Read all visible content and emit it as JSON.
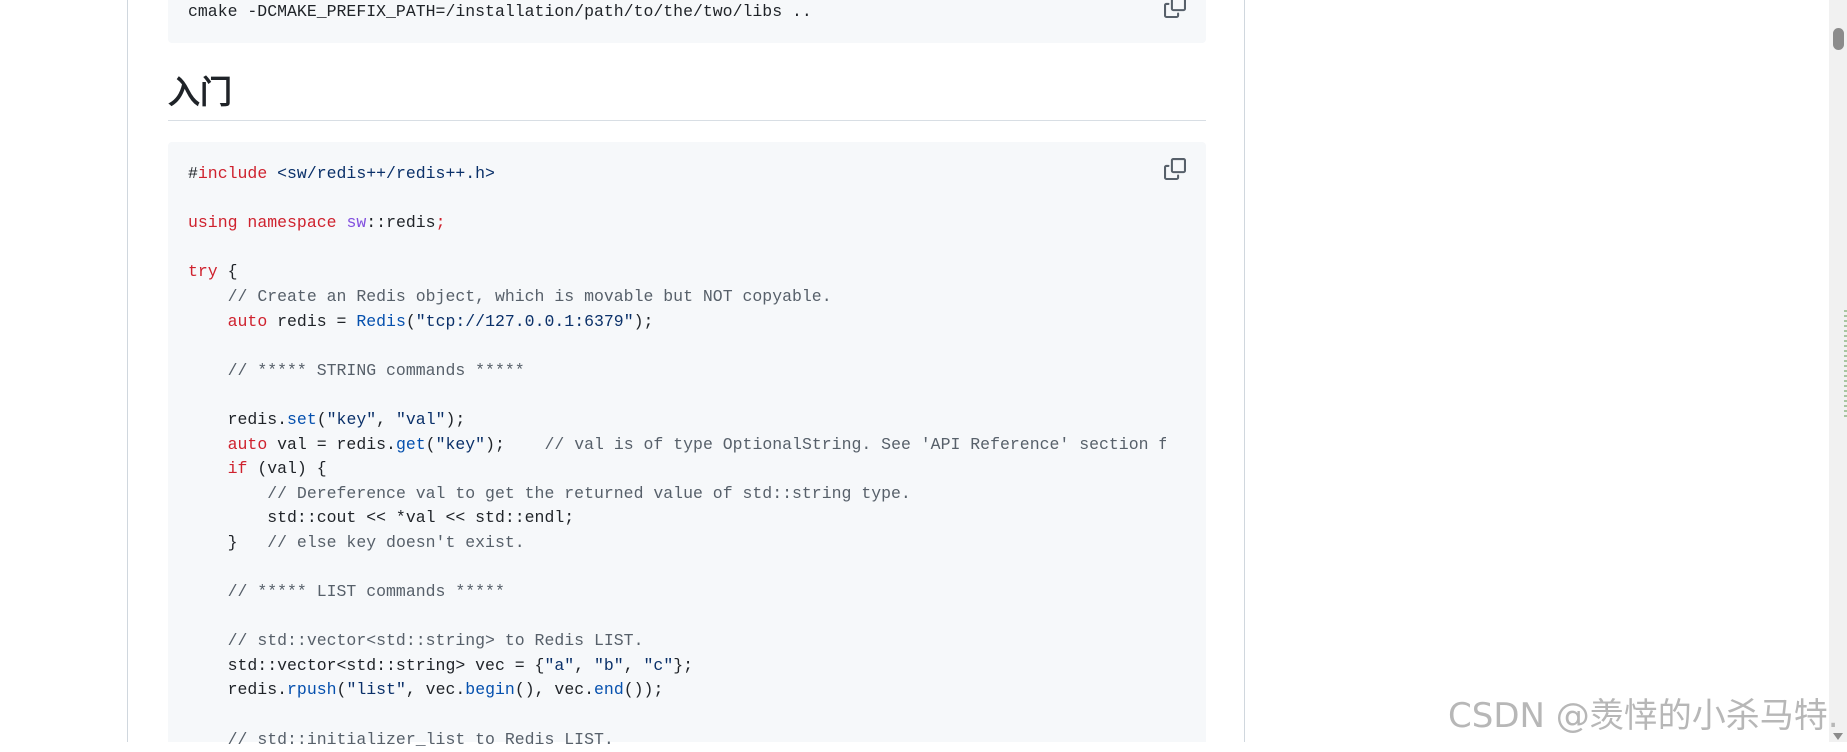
{
  "install_block": {
    "command": "cmake -DCMAKE_PREFIX_PATH=/installation/path/to/the/two/libs .."
  },
  "section": {
    "heading": "入门"
  },
  "code": {
    "lines": [
      [
        {
          "t": "#"
        },
        {
          "t": "include",
          "c": "k"
        },
        {
          "t": " "
        },
        {
          "t": "<sw/redis++/redis++.h>",
          "c": "s"
        }
      ],
      [],
      [
        {
          "t": "using",
          "c": "k"
        },
        {
          "t": " "
        },
        {
          "t": "namespace",
          "c": "k"
        },
        {
          "t": " "
        },
        {
          "t": "sw",
          "c": "n"
        },
        {
          "t": "::redis"
        },
        {
          "t": ";",
          "c": "k"
        }
      ],
      [],
      [
        {
          "t": "try",
          "c": "k"
        },
        {
          "t": " {"
        }
      ],
      [
        {
          "t": "    "
        },
        {
          "t": "// Create an Redis object, which is movable but NOT copyable.",
          "c": "c"
        }
      ],
      [
        {
          "t": "    "
        },
        {
          "t": "auto",
          "c": "k"
        },
        {
          "t": " redis = "
        },
        {
          "t": "Redis",
          "c": "f"
        },
        {
          "t": "("
        },
        {
          "t": "\"tcp://127.0.0.1:6379\"",
          "c": "s"
        },
        {
          "t": ");"
        }
      ],
      [],
      [
        {
          "t": "    "
        },
        {
          "t": "// ***** STRING commands *****",
          "c": "c"
        }
      ],
      [],
      [
        {
          "t": "    redis."
        },
        {
          "t": "set",
          "c": "f"
        },
        {
          "t": "("
        },
        {
          "t": "\"key\"",
          "c": "s"
        },
        {
          "t": ", "
        },
        {
          "t": "\"val\"",
          "c": "s"
        },
        {
          "t": ");"
        }
      ],
      [
        {
          "t": "    "
        },
        {
          "t": "auto",
          "c": "k"
        },
        {
          "t": " val = redis."
        },
        {
          "t": "get",
          "c": "f"
        },
        {
          "t": "("
        },
        {
          "t": "\"key\"",
          "c": "s"
        },
        {
          "t": ");    "
        },
        {
          "t": "// val is of type OptionalString. See 'API Reference' section for d",
          "c": "c"
        }
      ],
      [
        {
          "t": "    "
        },
        {
          "t": "if",
          "c": "k"
        },
        {
          "t": " (val) {"
        }
      ],
      [
        {
          "t": "        "
        },
        {
          "t": "// Dereference val to get the returned value of std::string type.",
          "c": "c"
        }
      ],
      [
        {
          "t": "        std::cout << *val << std::endl;"
        }
      ],
      [
        {
          "t": "    }   "
        },
        {
          "t": "// else key doesn't exist.",
          "c": "c"
        }
      ],
      [],
      [
        {
          "t": "    "
        },
        {
          "t": "// ***** LIST commands *****",
          "c": "c"
        }
      ],
      [],
      [
        {
          "t": "    "
        },
        {
          "t": "// std::vector<std::string> to Redis LIST.",
          "c": "c"
        }
      ],
      [
        {
          "t": "    std::vector<std::string> vec = {"
        },
        {
          "t": "\"a\"",
          "c": "s"
        },
        {
          "t": ", "
        },
        {
          "t": "\"b\"",
          "c": "s"
        },
        {
          "t": ", "
        },
        {
          "t": "\"c\"",
          "c": "s"
        },
        {
          "t": "};"
        }
      ],
      [
        {
          "t": "    redis."
        },
        {
          "t": "rpush",
          "c": "f"
        },
        {
          "t": "("
        },
        {
          "t": "\"list\"",
          "c": "s"
        },
        {
          "t": ", vec."
        },
        {
          "t": "begin",
          "c": "f"
        },
        {
          "t": "(), vec."
        },
        {
          "t": "end",
          "c": "f"
        },
        {
          "t": "());"
        }
      ],
      [],
      [
        {
          "t": "    "
        },
        {
          "t": "// std::initializer_list to Redis LIST.",
          "c": "c"
        }
      ]
    ]
  },
  "watermark": {
    "text": "CSDN @羡悻的小杀马特."
  }
}
